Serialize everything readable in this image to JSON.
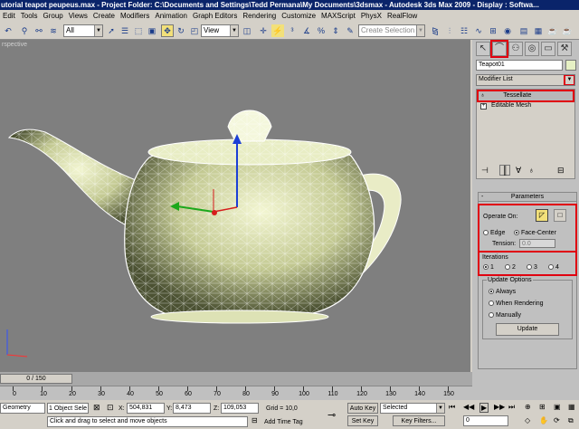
{
  "window": {
    "title": "utorial teapot peupeus.max   - Project Folder: C:\\Documents and Settings\\Tedd Permana\\My Documents\\3dsmax    - Autodesk 3ds Max  2009     - Display : Softwa..."
  },
  "menu": [
    "Edit",
    "Tools",
    "Group",
    "Views",
    "Create",
    "Modifiers",
    "Animation",
    "Graph Editors",
    "Rendering",
    "Customize",
    "MAXScript",
    "PhysX",
    "RealFlow"
  ],
  "toolbar": {
    "filter_value": "All",
    "view_value": "View",
    "selection_set_placeholder": "Create Selection Set"
  },
  "viewport": {
    "label": "rspective"
  },
  "panel": {
    "object_name": "Teapot01",
    "modifier_list_label": "Modifier List",
    "stack": [
      "Tessellate",
      "Editable Mesh"
    ],
    "parameters_title": "Parameters",
    "operate_on_label": "Operate On:",
    "edge_label": "Edge",
    "face_center_label": "Face-Center",
    "tension_label": "Tension:",
    "tension_value": "0.0",
    "iterations_label": "Iterations",
    "iterations": [
      "1",
      "2",
      "3",
      "4"
    ],
    "update_options_label": "Update Options",
    "always_label": "Always",
    "when_rendering_label": "When Rendering",
    "manually_label": "Manually",
    "update_button": "Update"
  },
  "timeline": {
    "slider_label": "0 / 150",
    "ticks": [
      "0",
      "10",
      "20",
      "30",
      "40",
      "50",
      "60",
      "70",
      "80",
      "90",
      "100",
      "110",
      "120",
      "130",
      "140",
      "150"
    ]
  },
  "status": {
    "object_count": "1 Object Sele",
    "x_label": "X:",
    "x_value": "504,831",
    "y_label": "Y:",
    "y_value": "8,473",
    "z_label": "Z:",
    "z_value": "109,053",
    "grid": "Grid = 10,0",
    "auto_key": "Auto Key",
    "set_key": "Set Key",
    "key_mode_value": "Selected",
    "key_filters": "Key Filters...",
    "frame_value": "0",
    "prompt": "Click and drag to select and move objects",
    "add_time_tag": "Add Time Tag",
    "maxscript": "Geometry"
  }
}
